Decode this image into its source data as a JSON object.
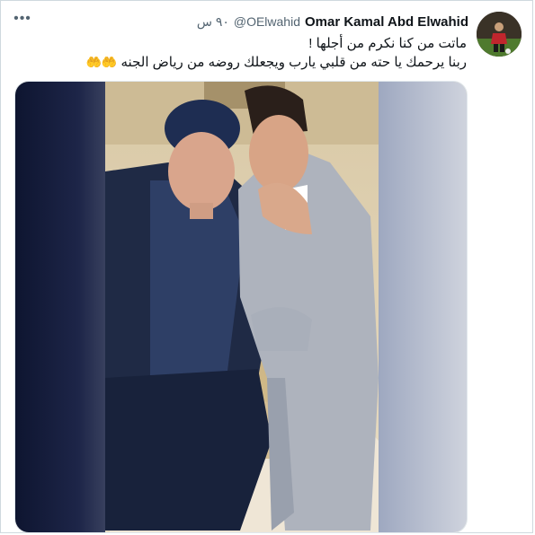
{
  "tweet": {
    "author_name": "Omar Kamal Abd Elwahid",
    "author_handle": "@OElwahid",
    "time_label": "٩٠ س",
    "text_line_1": "ماتت من كنا نكرم من أجلها !",
    "text_line_2": "ربنا يرحمك يا حته من قلبي يارب ويجعلك روضه من رياض الجنه",
    "emoji": "🤲🤲"
  },
  "icons": {
    "more": "more-options-icon"
  },
  "colors": {
    "text_primary": "#0f1419",
    "text_secondary": "#536471",
    "border": "#cfd9de"
  }
}
